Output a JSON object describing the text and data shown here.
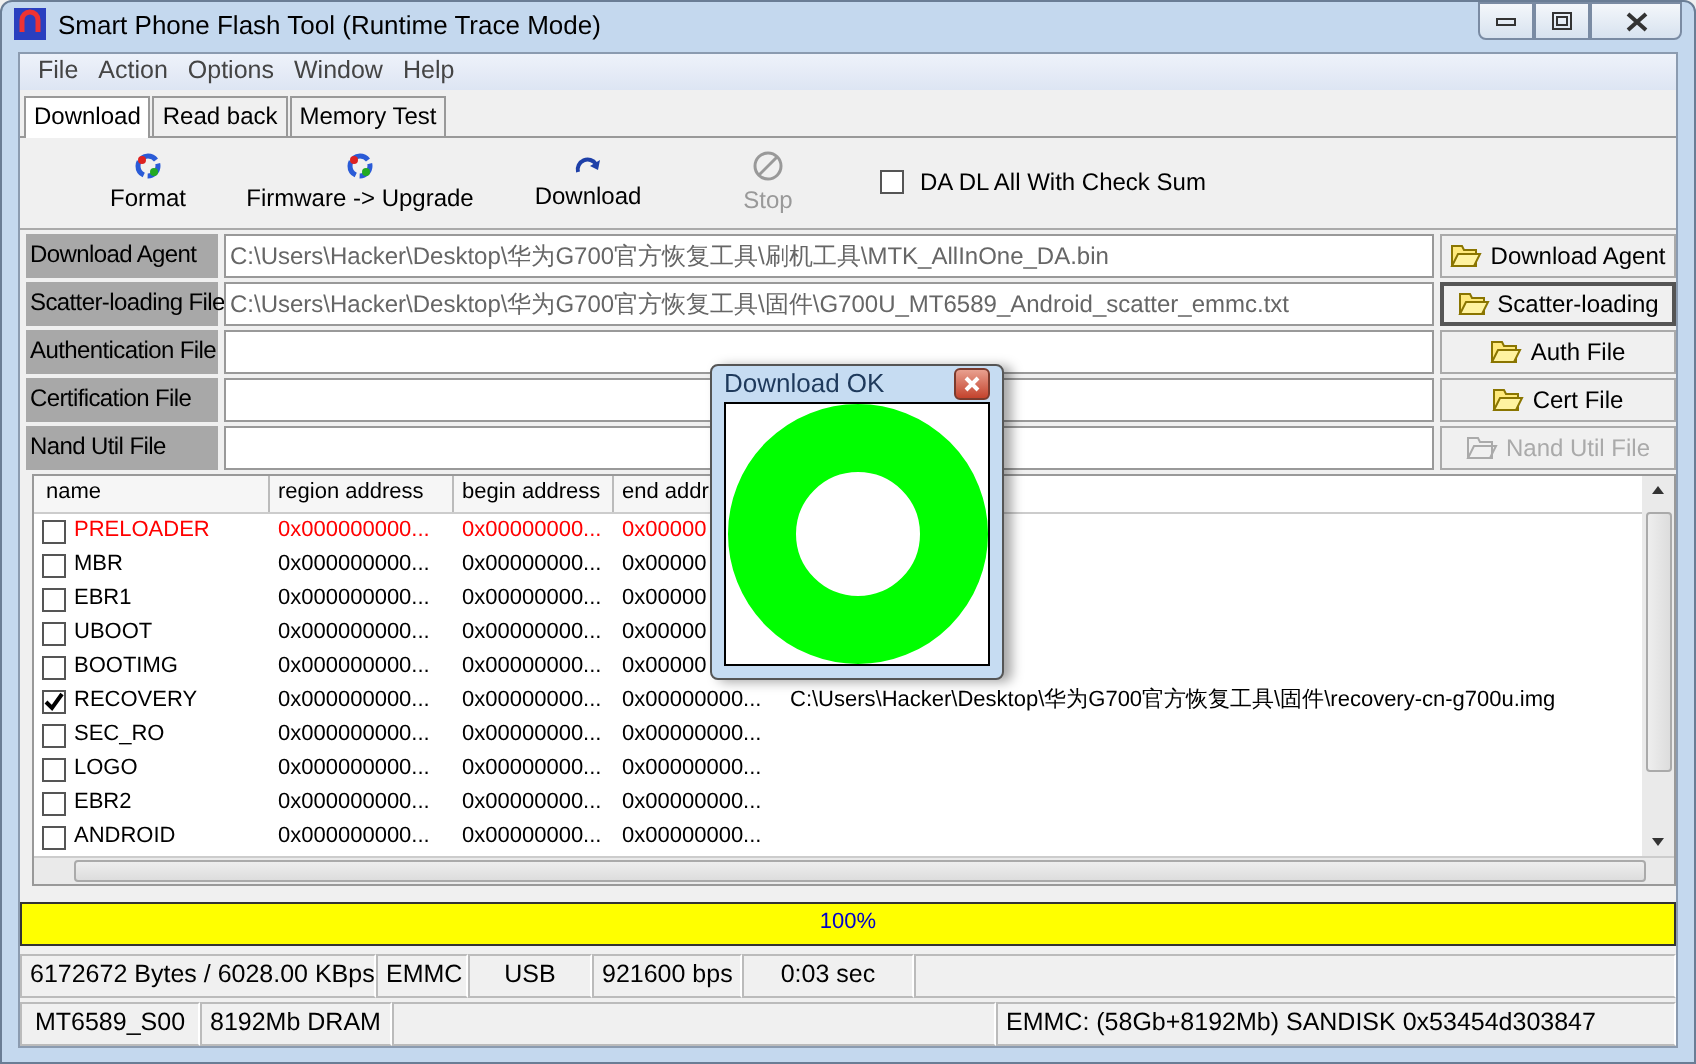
{
  "window": {
    "title": "Smart Phone Flash Tool (Runtime Trace Mode)"
  },
  "menu": [
    "File",
    "Action",
    "Options",
    "Window",
    "Help"
  ],
  "tabs": [
    {
      "label": "Download",
      "selected": true
    },
    {
      "label": "Read back",
      "selected": false
    },
    {
      "label": "Memory Test",
      "selected": false
    }
  ],
  "toolbar": [
    {
      "label": "Format",
      "kind": "format",
      "disabled": false
    },
    {
      "label": "Firmware -> Upgrade",
      "kind": "format",
      "disabled": false
    },
    {
      "label": "Download",
      "kind": "download",
      "disabled": false
    },
    {
      "label": "Stop",
      "kind": "stop",
      "disabled": true
    }
  ],
  "checksum": {
    "label": "DA DL All With Check Sum",
    "checked": false
  },
  "files": [
    {
      "label": "Download Agent",
      "value": "C:\\Users\\Hacker\\Desktop\\华为G700官方恢复工具\\刷机工具\\MTK_AllInOne_DA.bin",
      "button": "Download Agent",
      "disabled": false,
      "selected": false
    },
    {
      "label": "Scatter-loading File",
      "value": "C:\\Users\\Hacker\\Desktop\\华为G700官方恢复工具\\固件\\G700U_MT6589_Android_scatter_emmc.txt",
      "button": "Scatter-loading",
      "disabled": false,
      "selected": true
    },
    {
      "label": "Authentication File",
      "button": "Auth File",
      "disabled": false,
      "selected": false
    },
    {
      "label": "Certification File",
      "button": "Cert File",
      "disabled": false,
      "selected": false
    },
    {
      "label": "Nand Util File",
      "button": "Nand Util File",
      "disabled": true,
      "selected": false
    }
  ],
  "table": {
    "columns": [
      "name",
      "region address",
      "begin address",
      "end addr"
    ],
    "rows": [
      {
        "name": "PRELOADER",
        "checked": false,
        "highlighted": true,
        "region": "0x000000000...",
        "begin": "0x00000000...",
        "end": "0x00000"
      },
      {
        "name": "MBR",
        "checked": false,
        "highlighted": false,
        "region": "0x000000000...",
        "begin": "0x00000000...",
        "end": "0x00000"
      },
      {
        "name": "EBR1",
        "checked": false,
        "highlighted": false,
        "region": "0x000000000...",
        "begin": "0x00000000...",
        "end": "0x00000"
      },
      {
        "name": "UBOOT",
        "checked": false,
        "highlighted": false,
        "region": "0x000000000...",
        "begin": "0x00000000...",
        "end": "0x00000"
      },
      {
        "name": "BOOTIMG",
        "checked": false,
        "highlighted": false,
        "region": "0x000000000...",
        "begin": "0x00000000...",
        "end": "0x00000"
      },
      {
        "name": "RECOVERY",
        "checked": true,
        "highlighted": false,
        "region": "0x000000000...",
        "begin": "0x00000000...",
        "end": "0x00000000...",
        "path": "C:\\Users\\Hacker\\Desktop\\华为G700官方恢复工具\\固件\\recovery-cn-g700u.img"
      },
      {
        "name": "SEC_RO",
        "checked": false,
        "highlighted": false,
        "region": "0x000000000...",
        "begin": "0x00000000...",
        "end": "0x00000000..."
      },
      {
        "name": "LOGO",
        "checked": false,
        "highlighted": false,
        "region": "0x000000000...",
        "begin": "0x00000000...",
        "end": "0x00000000..."
      },
      {
        "name": "EBR2",
        "checked": false,
        "highlighted": false,
        "region": "0x000000000...",
        "begin": "0x00000000...",
        "end": "0x00000000..."
      },
      {
        "name": "ANDROID",
        "checked": false,
        "highlighted": false,
        "region": "0x000000000...",
        "begin": "0x00000000...",
        "end": "0x00000000..."
      }
    ]
  },
  "progress": {
    "level": 1.0,
    "text": "100%"
  },
  "status_bar": [
    [
      "6172672 Bytes / 6028.00 KBps",
      "EMMC",
      "USB",
      "921600 bps",
      "0:03 sec"
    ],
    [
      "MT6589_S00",
      "8192Mb DRAM",
      "EMMC: (58Gb+8192Mb) SANDISK 0x53454d303847"
    ]
  ],
  "dialog": {
    "title": "Download OK"
  }
}
